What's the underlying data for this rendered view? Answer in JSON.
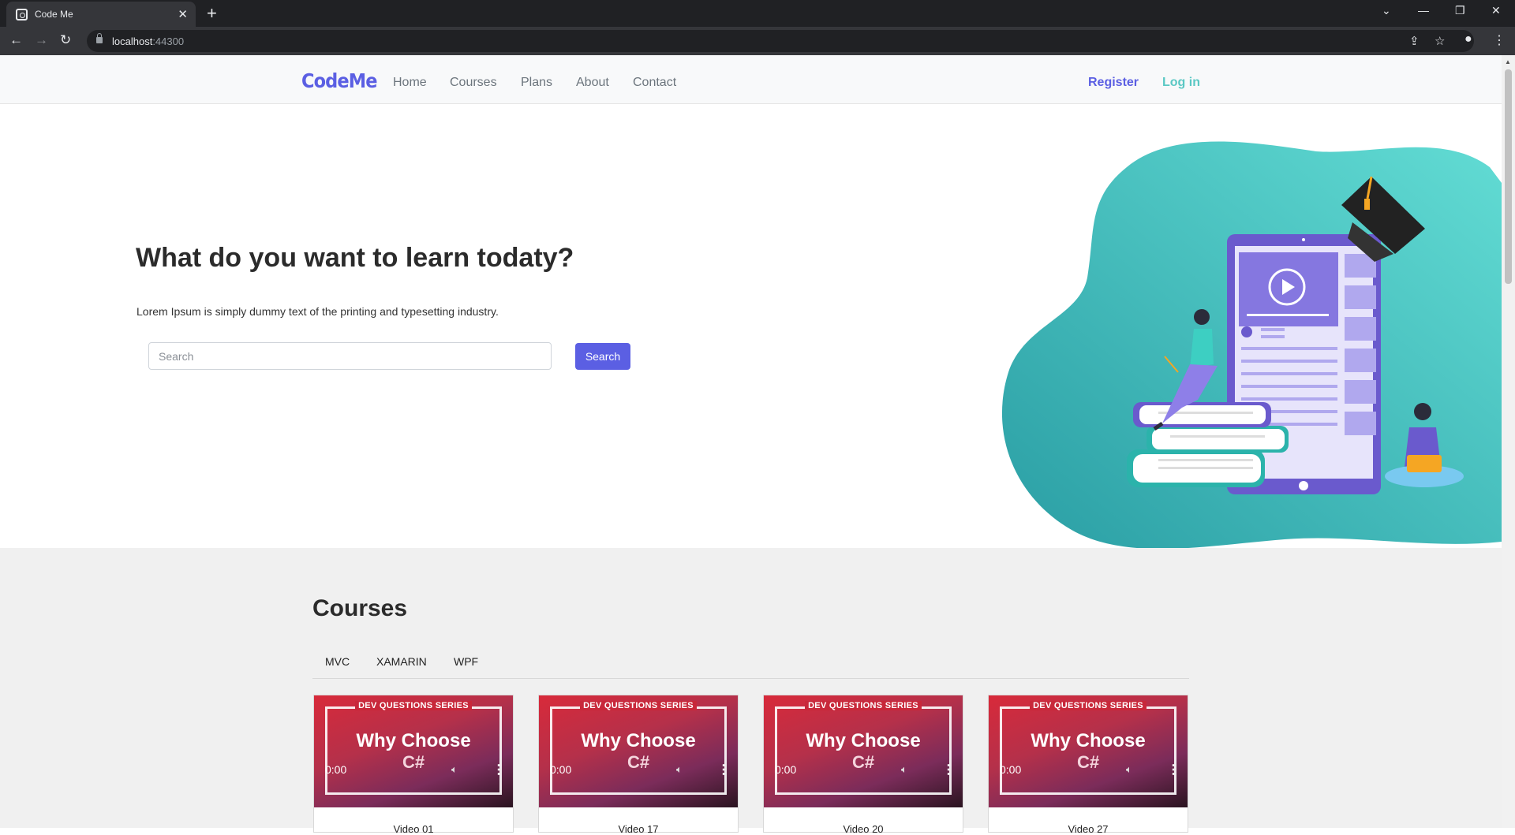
{
  "browser": {
    "tab_title": "Code Me",
    "url_host": "localhost",
    "url_port": ":44300"
  },
  "nav": {
    "logo": "CodeMe",
    "links": [
      "Home",
      "Courses",
      "Plans",
      "About",
      "Contact"
    ],
    "register": "Register",
    "login": "Log in"
  },
  "hero": {
    "heading": "What do you want to learn todaty?",
    "lead": "Lorem Ipsum is simply dummy text of the printing and typesetting industry.",
    "search_placeholder": "Search",
    "search_button": "Search"
  },
  "courses": {
    "heading": "Courses",
    "tabs": [
      "MVC",
      "XAMARIN",
      "WPF"
    ],
    "cards": [
      {
        "series": "DEV QUESTIONS SERIES",
        "line1": "Why Choose",
        "line2": "C#",
        "time": "0:00",
        "title": "Video 01"
      },
      {
        "series": "DEV QUESTIONS SERIES",
        "line1": "Why Choose",
        "line2": "C#",
        "time": "0:00",
        "title": "Video 17"
      },
      {
        "series": "DEV QUESTIONS SERIES",
        "line1": "Why Choose",
        "line2": "C#",
        "time": "0:00",
        "title": "Video 20"
      },
      {
        "series": "DEV QUESTIONS SERIES",
        "line1": "Why Choose",
        "line2": "C#",
        "time": "0:00",
        "title": "Video 27"
      }
    ]
  },
  "colors": {
    "brand": "#5b5fe3",
    "accent_teal": "#5bc8c4",
    "hero_blob": "#3fb8b2"
  }
}
